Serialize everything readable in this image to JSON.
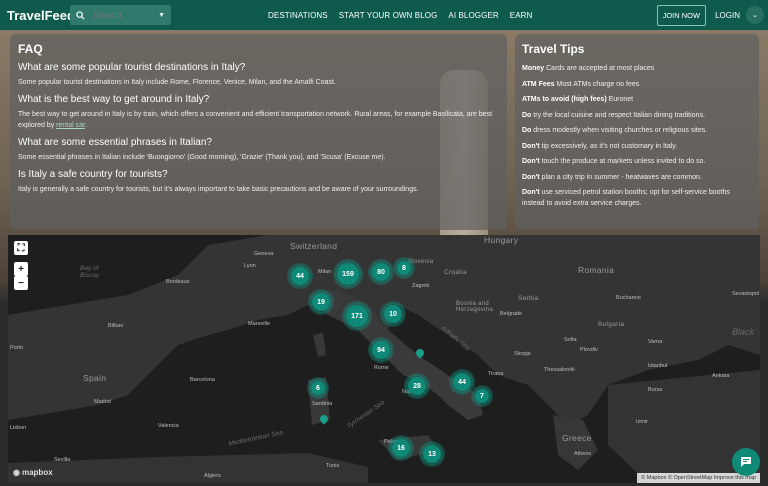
{
  "header": {
    "brand": "TravelFeed",
    "search_placeholder": "Search",
    "nav": [
      "DESTINATIONS",
      "START YOUR OWN BLOG",
      "AI BLOGGER",
      "EARN"
    ],
    "join": "JOIN NOW",
    "login": "LOGIN"
  },
  "faq": {
    "title": "FAQ",
    "items": [
      {
        "q": "What are some popular tourist destinations in Italy?",
        "a": "Some popular tourist destinations in Italy include Rome, Florence, Venice, Milan, and the Amalfi Coast."
      },
      {
        "q": "What is the best way to get around in Italy?",
        "a": "The best way to get around in Italy is by train, which offers a convenient and efficient transportation network. Rural areas, for example Basilicata, are best explored by ",
        "link": "rental car",
        "a_end": "."
      },
      {
        "q": "What are some essential phrases in Italian?",
        "a": "Some essential phrases in Italian include 'Buongiorno' (Good morning), 'Grazie' (Thank you), and 'Scusa' (Excuse me)."
      },
      {
        "q": "Is Italy a safe country for tourists?",
        "a": "Italy is generally a safe country for tourists, but it's always important to take basic precautions and be aware of your surroundings."
      }
    ]
  },
  "tips": {
    "title": "Travel Tips",
    "items": [
      {
        "b": "Money",
        "t": " Cards are accepted at most places"
      },
      {
        "b": "ATM Fees",
        "t": " Most ATMs charge no fees"
      },
      {
        "b": "ATMs to avoid (high fees)",
        "t": " Euronet"
      },
      {
        "b": "Do",
        "t": " try the local cuisine and respect Italian dining traditions."
      },
      {
        "b": "Do",
        "t": " dress modestly when visiting churches or religious sites."
      },
      {
        "b": "Don't",
        "t": " tip excessively, as it's not customary in Italy."
      },
      {
        "b": "Don't",
        "t": " touch the produce at markets unless invited to do so."
      },
      {
        "b": "Don't",
        "t": " plan a city trip in summer - heatwaves are common."
      },
      {
        "b": "Don't",
        "t": " use serviced petrol station booths; opt for self-service booths instead to avoid extra service charges."
      }
    ]
  },
  "map": {
    "countries": [
      "Switzerland",
      "Hungary",
      "Romania",
      "Slovenia",
      "Croatia",
      "Bosnia and Herzegovina",
      "Serbia",
      "Bulgaria",
      "Spain",
      "Greece"
    ],
    "seas": [
      "Bay of Biscay",
      "Black",
      "Mediterranean Sea",
      "Adriatic Sea",
      "Tyrrhenian Sea"
    ],
    "cities": [
      "Geneva",
      "Lyon",
      "Milan",
      "Bordeaux",
      "Marseille",
      "Bilbao",
      "Rome",
      "Barcelona",
      "Madrid",
      "Naples",
      "Sardinia",
      "Palermo",
      "Bucharest",
      "Sevastopol",
      "Sofia",
      "Thessaloniki",
      "Istanbul",
      "Ankara",
      "Athens",
      "Izmir",
      "Sevilla",
      "Porto",
      "Valencia",
      "Zagreb",
      "Belgrade",
      "Skopje",
      "Tirana",
      "Bursa",
      "Varna",
      "Plovdiv",
      "Lisbon",
      "Algiers",
      "Tunis"
    ],
    "clusters": [
      "44",
      "159",
      "80",
      "8",
      "19",
      "171",
      "10",
      "94",
      "28",
      "44",
      "7",
      "6",
      "16",
      "13"
    ],
    "zoom_in": "+",
    "zoom_out": "−",
    "mapbox": "mapbox",
    "attribution": "© Mapbox © OpenStreetMap Improve this map"
  }
}
